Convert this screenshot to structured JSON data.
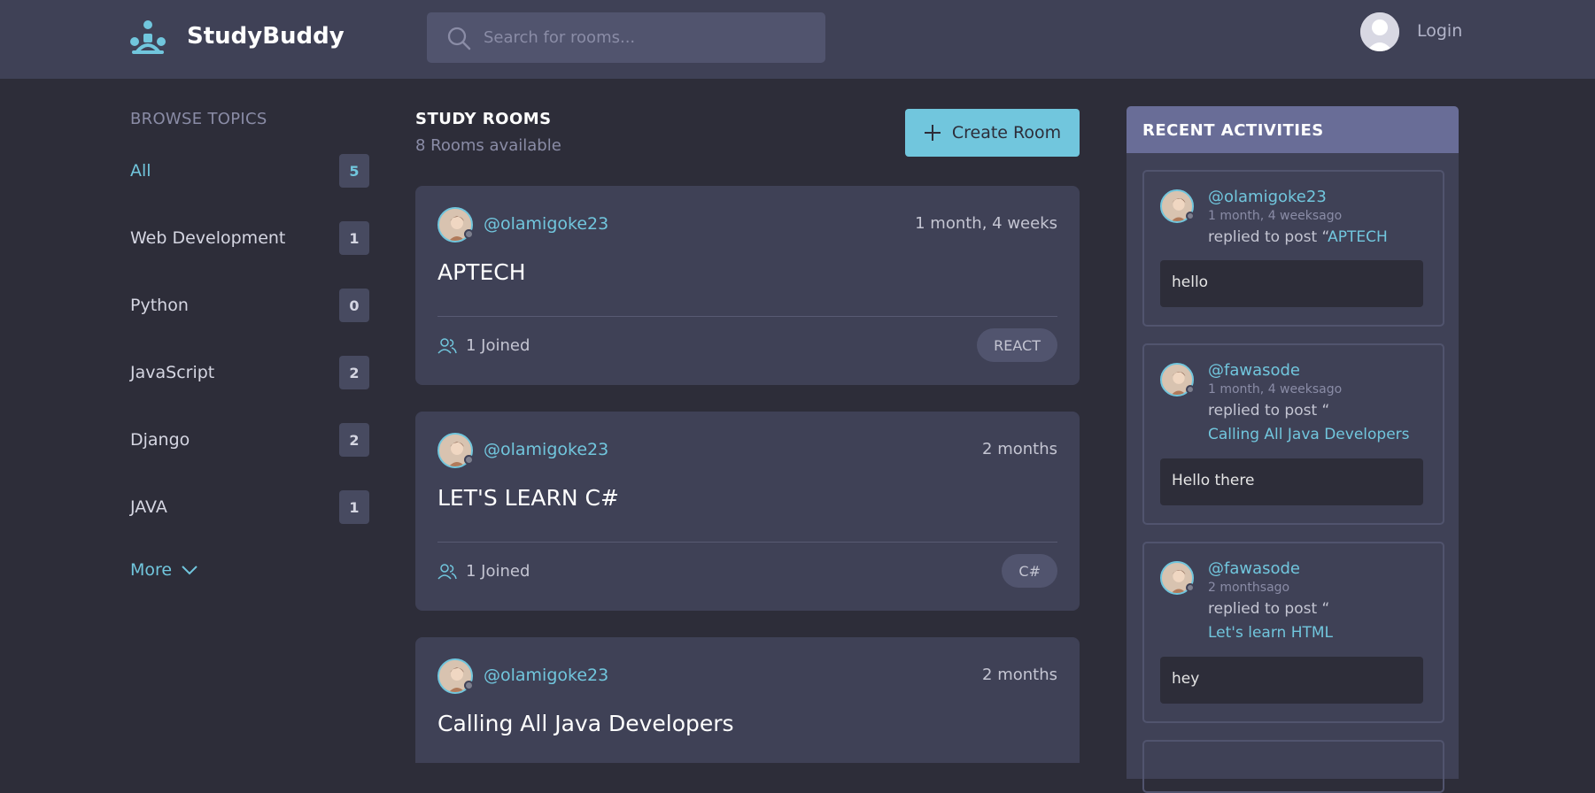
{
  "header": {
    "brand": "StudyBuddy",
    "search_placeholder": "Search for rooms...",
    "login_label": "Login"
  },
  "sidebar": {
    "title": "BROWSE TOPICS",
    "topics": [
      {
        "label": "All",
        "count": "5"
      },
      {
        "label": "Web Development",
        "count": "1"
      },
      {
        "label": "Python",
        "count": "0"
      },
      {
        "label": "JavaScript",
        "count": "2"
      },
      {
        "label": "Django",
        "count": "2"
      },
      {
        "label": "JAVA",
        "count": "1"
      }
    ],
    "more_label": "More"
  },
  "main": {
    "title": "STUDY ROOMS",
    "subtitle": "8 Rooms available",
    "create_label": "Create Room",
    "rooms": [
      {
        "host": "@olamigoke23",
        "time": "1 month, 4 weeks",
        "title": "APTECH",
        "joined": "1 Joined",
        "topic": "REACT"
      },
      {
        "host": "@olamigoke23",
        "time": "2 months",
        "title": "LET'S LEARN C#",
        "joined": "1 Joined",
        "topic": "C#"
      },
      {
        "host": "@olamigoke23",
        "time": "2 months",
        "title": "Calling All Java Developers",
        "joined": "",
        "topic": ""
      }
    ]
  },
  "activity": {
    "title": "RECENT ACTIVITIES",
    "items": [
      {
        "user": "@olamigoke23",
        "time": "1 month, 4 weeksago",
        "action": "replied to post “",
        "room": "APTECH",
        "message": "hello"
      },
      {
        "user": "@fawasode",
        "time": "1 month, 4 weeksago",
        "action": "replied to post “",
        "room": "Calling All Java Developers",
        "message": "Hello there"
      },
      {
        "user": "@fawasode",
        "time": "2 monthsago",
        "action": "replied to post “",
        "room": "Let's learn HTML",
        "message": "hey"
      }
    ]
  },
  "colors": {
    "accent": "#71c6dd",
    "background": "#2d2d39",
    "surface": "#3f4156",
    "activity_header": "#696d97"
  },
  "icons": [
    "study-buddy-logo-icon",
    "search-icon",
    "user-avatar-icon",
    "plus-icon",
    "chevron-down-icon",
    "users-icon"
  ]
}
